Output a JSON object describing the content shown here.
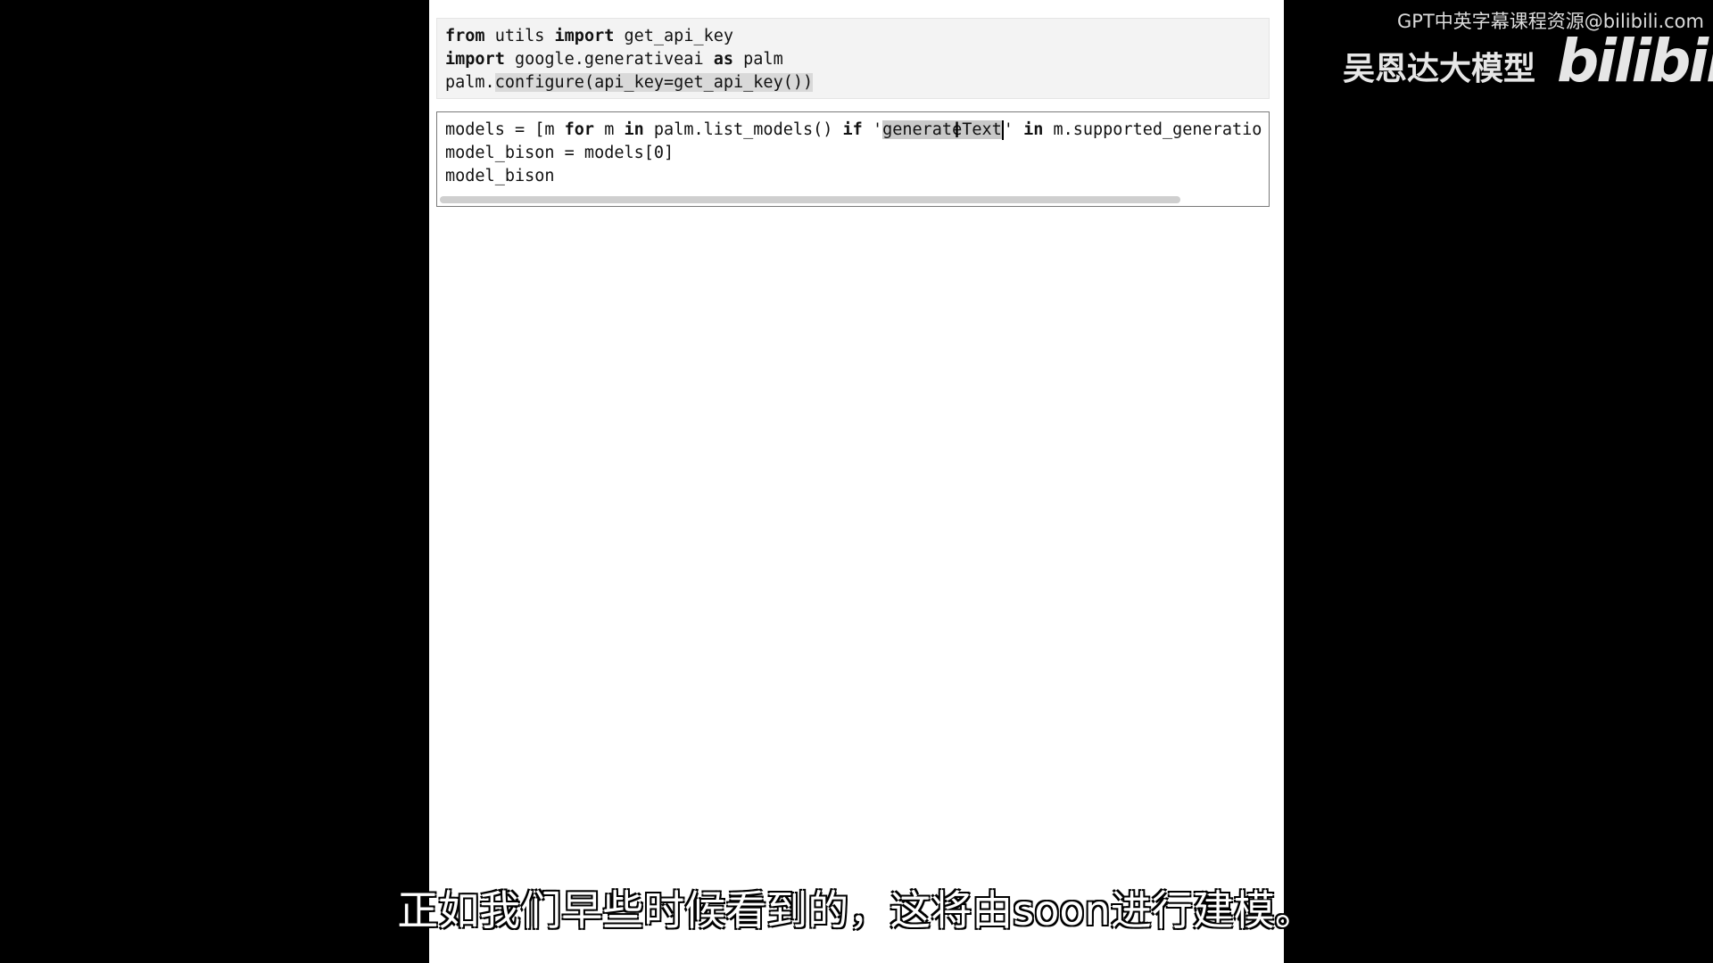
{
  "watermark": {
    "top_text": "GPT中英字幕课程资源@bilibili.com",
    "brand_text": "吴恩达大模型",
    "logo_text": "bilibili"
  },
  "cells": [
    {
      "lines": [
        [
          "from",
          " utils ",
          "import",
          " get_api_key"
        ],
        [
          "import",
          " google.generativeai ",
          "as",
          " palm"
        ],
        [
          "palm.",
          "configure(api_key=get_api_key())"
        ]
      ]
    },
    {
      "line1": {
        "a": "models = [m ",
        "kw_for": "for",
        "b": " m ",
        "kw_in": "in",
        "c": " palm.list_models() ",
        "kw_if": "if",
        "d": " '",
        "sel1": "generat",
        "sel2": "eText",
        "e": "' ",
        "kw_in2": "in",
        "f": " m.supported_generatio"
      },
      "line2": "model_bison = models[0]",
      "line3": "model_bison"
    }
  ],
  "subtitle": "正如我们早些时候看到的，这将由soon进行建模。"
}
